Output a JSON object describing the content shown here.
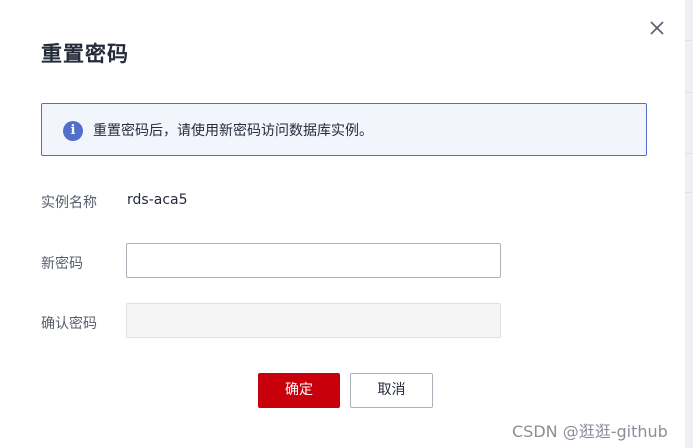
{
  "dialog": {
    "title": "重置密码",
    "close_icon": "close-icon"
  },
  "info": {
    "icon": "info-icon",
    "icon_glyph": "i",
    "text": "重置密码后，请使用新密码访问数据库实例。",
    "accent_color": "#526ecc"
  },
  "form": {
    "instance_name_label": "实例名称",
    "instance_name_value": "rds-aca5",
    "new_password_label": "新密码",
    "new_password_value": "",
    "confirm_password_label": "确认密码",
    "confirm_password_value": ""
  },
  "buttons": {
    "confirm_label": "确定",
    "cancel_label": "取消",
    "primary_color": "#c7000b"
  },
  "watermark": "CSDN @逛逛-github"
}
